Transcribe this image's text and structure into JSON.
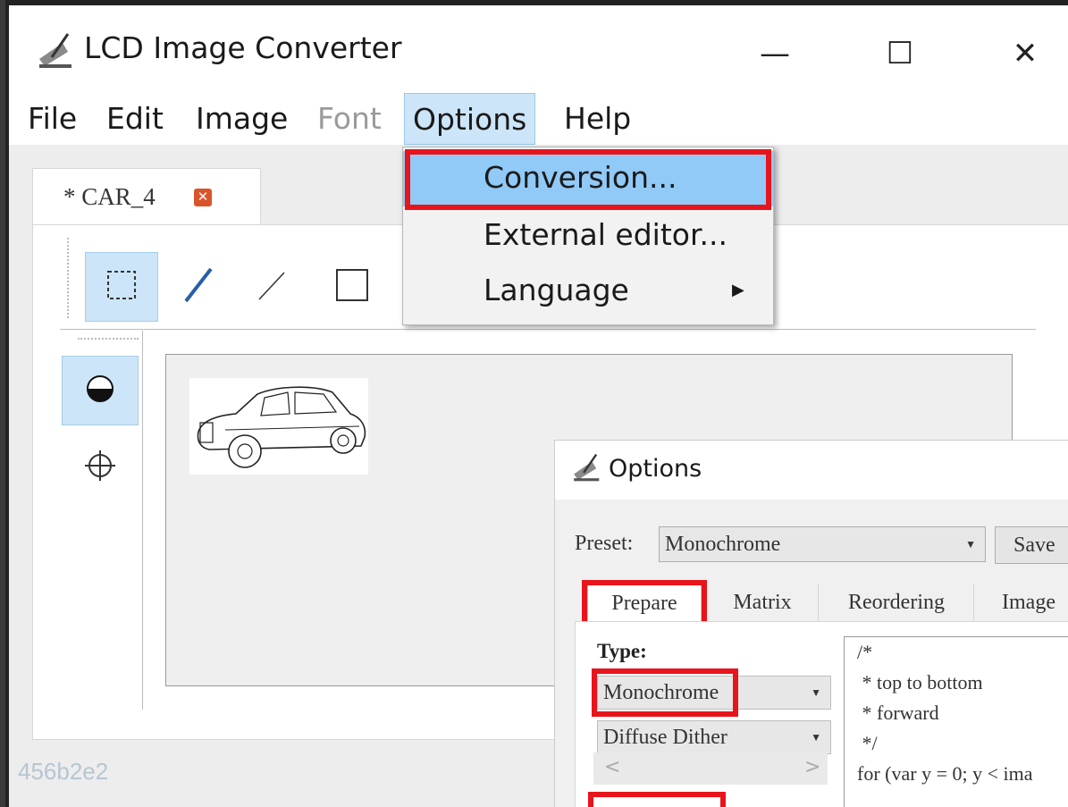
{
  "window": {
    "title": "LCD Image Converter",
    "controls": {
      "minimize": "—",
      "maximize": "☐",
      "close": "✕"
    }
  },
  "menubar": {
    "items": [
      {
        "label": "File",
        "enabled": true
      },
      {
        "label": "Edit",
        "enabled": true
      },
      {
        "label": "Image",
        "enabled": true
      },
      {
        "label": "Font",
        "enabled": false
      },
      {
        "label": "Options",
        "enabled": true,
        "open": true
      },
      {
        "label": "Help",
        "enabled": true
      }
    ]
  },
  "options_menu": {
    "items": [
      {
        "label": "Conversion...",
        "highlighted": true
      },
      {
        "label": "External editor..."
      },
      {
        "label": "Language",
        "submenu": true
      }
    ]
  },
  "document_tab": {
    "label": "* CAR_4",
    "close_icon": "close-icon"
  },
  "toolbar": {
    "tools": [
      "select-rect-icon",
      "pen-icon",
      "line-icon",
      "rect-icon"
    ],
    "side_tools": [
      "fill-icon",
      "move-icon"
    ]
  },
  "background_text": "456b2e2",
  "options_dialog": {
    "title": "Options",
    "preset_label": "Preset:",
    "preset_value": "Monochrome",
    "save_label": "Save",
    "tabs": [
      "Prepare",
      "Matrix",
      "Reordering",
      "Image"
    ],
    "active_tab": "Prepare",
    "type_label": "Type:",
    "type_value": "Monochrome",
    "dither_value": "Diffuse Dither",
    "scroll_left": "<",
    "scroll_right": ">",
    "code_lines": [
      "/*",
      " * top to bottom",
      " * forward",
      " */",
      "",
      "for (var y = 0; y < ima"
    ]
  },
  "colors": {
    "highlight": "#91c9f7",
    "annotation_red": "#e8141b",
    "active_tool": "#cce5f8"
  }
}
